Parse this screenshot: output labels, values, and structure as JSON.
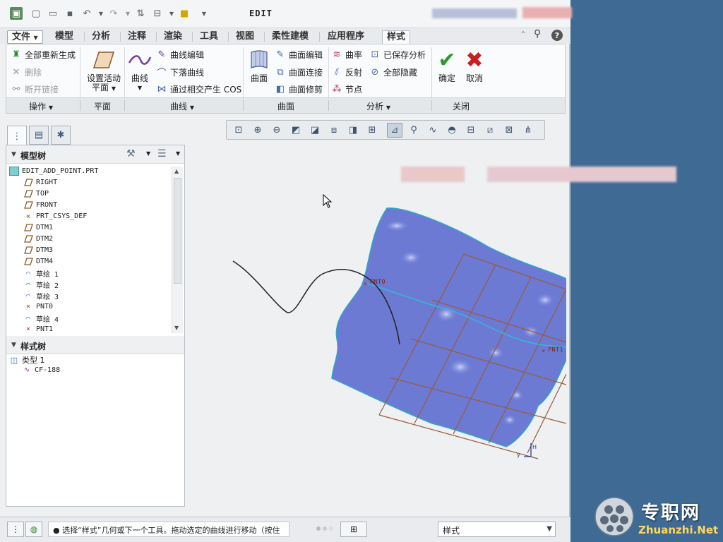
{
  "title": "EDIT",
  "tabs": [
    "文件",
    "模型",
    "分析",
    "注释",
    "渲染",
    "工具",
    "视图",
    "柔性建模",
    "应用程序",
    "样式"
  ],
  "ribbon": {
    "ops": {
      "regen": "全部重新生成",
      "delete": "删除",
      "unlink": "断开链接"
    },
    "plane": {
      "set_active": "设置活动",
      "plane": "平面"
    },
    "curves": {
      "curve": "曲线",
      "curve_edit": "曲线编辑",
      "drop_curve": "下落曲线",
      "cos": "通过相交产生 COS"
    },
    "surfaces": {
      "surface": "曲面",
      "surface_edit": "曲面编辑",
      "surface_connect": "曲面连接",
      "surface_trim": "曲面修剪"
    },
    "analysis": {
      "curvature": "曲率",
      "saved": "已保存分析",
      "reflect": "反射",
      "hide_all": "全部隐藏",
      "node": "节点"
    },
    "close": {
      "ok": "确定",
      "cancel": "取消"
    },
    "groups": {
      "ops": "操作",
      "plane": "平面",
      "curves": "曲线",
      "surfaces": "曲面",
      "analysis": "分析",
      "close": "关闭"
    }
  },
  "model_tree": {
    "title": "模型树",
    "items": [
      "EDIT_ADD_POINT.PRT",
      "RIGHT",
      "TOP",
      "FRONT",
      "PRT_CSYS_DEF",
      "DTM1",
      "DTM2",
      "DTM3",
      "DTM4",
      "草绘 1",
      "草绘 2",
      "草绘 3",
      "PNT0",
      "草绘 4",
      "PNT1"
    ]
  },
  "style_tree": {
    "title": "样式树",
    "items": [
      "类型 1",
      "CF-188"
    ]
  },
  "graphics": {
    "pnt0": "PNT0",
    "pnt1": "PNT1"
  },
  "status": {
    "message": "● 选择“样式”几何或下一个工具。拖动选定的曲线进行移动（按住",
    "filter": "样式"
  },
  "logo": {
    "cn": "专职网",
    "en": "Zhuanzhi.Net"
  },
  "colors": {
    "surface": "#6a78d2",
    "grid": "#9a5a3a",
    "accent_red": "#c62020",
    "accent_green": "#2e9a2e"
  }
}
